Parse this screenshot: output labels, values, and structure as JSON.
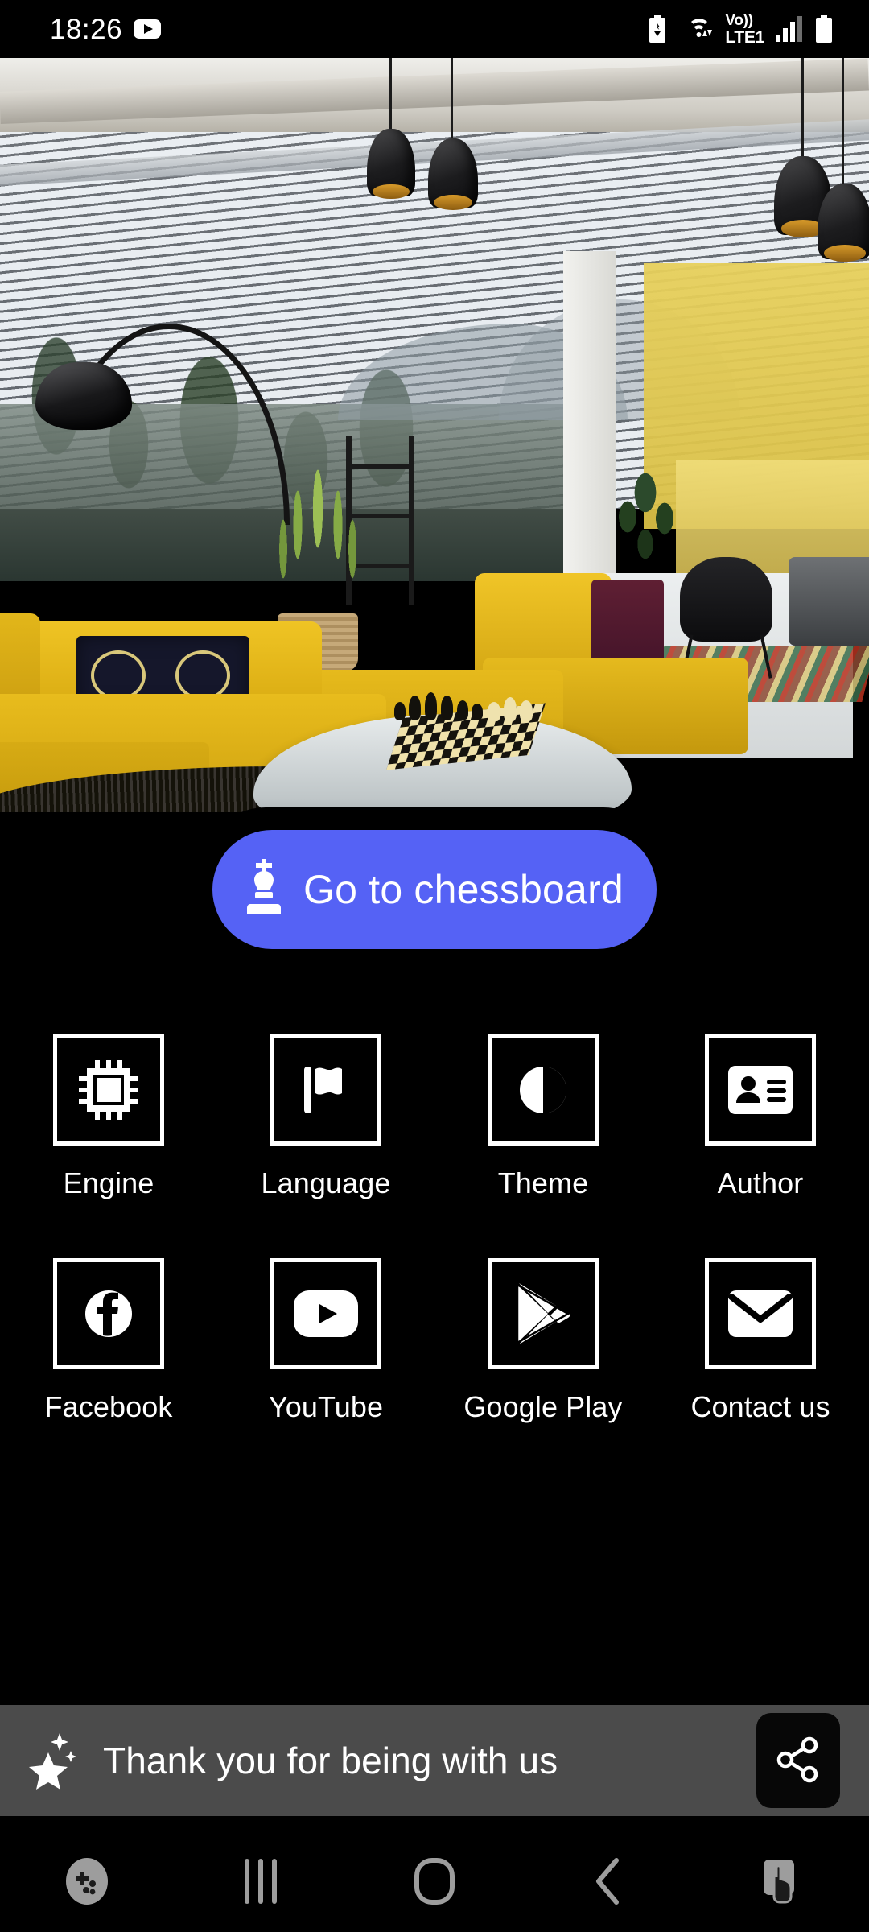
{
  "status_bar": {
    "time": "18:26",
    "notification_icon": "youtube-icon",
    "icons": [
      "battery-saver-icon",
      "wifi-icon",
      "volte-icon",
      "signal-icon",
      "battery-icon"
    ],
    "volte_line1": "Vo))",
    "volte_line2": "LTE1"
  },
  "hero": {
    "alt": "modern living room with yellow modular sofa, chess set on coffee table and mountain view",
    "icon": "interior-photo"
  },
  "cta": {
    "label": "Go to chessboard",
    "icon": "chess-king-icon",
    "color": "#5562f5",
    "text_color": "#ffffff"
  },
  "grid": {
    "items": [
      {
        "label": "Engine",
        "icon": "cpu-chip-icon"
      },
      {
        "label": "Language",
        "icon": "flag-icon"
      },
      {
        "label": "Theme",
        "icon": "contrast-circle-icon"
      },
      {
        "label": "Author",
        "icon": "id-card-icon"
      },
      {
        "label": "Facebook",
        "icon": "facebook-icon"
      },
      {
        "label": "YouTube",
        "icon": "youtube-icon"
      },
      {
        "label": "Google Play",
        "icon": "google-play-icon"
      },
      {
        "label": "Contact us",
        "icon": "envelope-icon"
      }
    ]
  },
  "promo": {
    "text": "Thank you for being with us",
    "star_icon": "sparkle-star-icon",
    "share_icon": "share-icon",
    "background": "#4b4b4b"
  },
  "nav_bar": {
    "items": [
      {
        "icon": "game-controller-icon"
      },
      {
        "icon": "recents-icon"
      },
      {
        "icon": "home-icon"
      },
      {
        "icon": "back-icon"
      },
      {
        "icon": "screen-touch-icon"
      }
    ]
  }
}
